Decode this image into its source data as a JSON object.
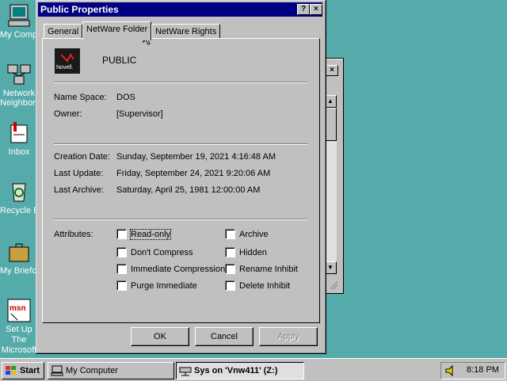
{
  "desktop": {
    "icons": [
      {
        "label": "My Computer",
        "icon": "computer-icon"
      },
      {
        "label": "Network Neighborhood",
        "icon": "network-icon"
      },
      {
        "label": "Inbox",
        "icon": "inbox-icon"
      },
      {
        "label": "Recycle Bin",
        "icon": "recycle-bin-icon"
      },
      {
        "label": "My Briefcase",
        "icon": "briefcase-icon"
      },
      {
        "label": "Set Up The Microsoft Network",
        "icon": "msn-icon"
      }
    ]
  },
  "dialog": {
    "title": "Public Properties",
    "help_glyph": "?",
    "close_glyph": "×",
    "tabs": [
      {
        "label": "General",
        "active": false
      },
      {
        "label": "NetWare Folder",
        "active": true
      },
      {
        "label": "NetWare Rights",
        "active": false
      }
    ],
    "logo_text": "Novell.",
    "folder_name": "PUBLIC",
    "name_space_label": "Name Space:",
    "name_space_value": "DOS",
    "owner_label": "Owner:",
    "owner_value": "[Supervisor]",
    "creation_label": "Creation Date:",
    "creation_value": "Sunday, September 19, 2021 4:16:48 AM",
    "update_label": "Last Update:",
    "update_value": "Friday, September 24, 2021 9:20:06 AM",
    "archive_label": "Last Archive:",
    "archive_value": "Saturday, April 25, 1981 12:00:00 AM",
    "attributes_label": "Attributes:",
    "attributes_left": [
      {
        "label": "Read-only",
        "checked": false
      },
      {
        "label": "Don't Compress",
        "checked": false
      },
      {
        "label": "Immediate Compression",
        "checked": false
      },
      {
        "label": "Purge Immediate",
        "checked": false
      }
    ],
    "attributes_right": [
      {
        "label": "Archive",
        "checked": false
      },
      {
        "label": "Hidden",
        "checked": false
      },
      {
        "label": "Rename Inhibit",
        "checked": false
      },
      {
        "label": "Delete Inhibit",
        "checked": false
      }
    ],
    "ok_label": "OK",
    "cancel_label": "Cancel",
    "apply_label": "Apply"
  },
  "taskbar": {
    "start_label": "Start",
    "items": [
      {
        "label": "My Computer",
        "icon": "computer-icon"
      },
      {
        "label": "Sys on 'Vnw411' (Z:)",
        "icon": "network-drive-icon"
      }
    ],
    "clock": "8:18 PM"
  },
  "colors": {
    "desktop": "#55aaaa",
    "title_bar": "#000080",
    "face": "#c0c0c0"
  }
}
